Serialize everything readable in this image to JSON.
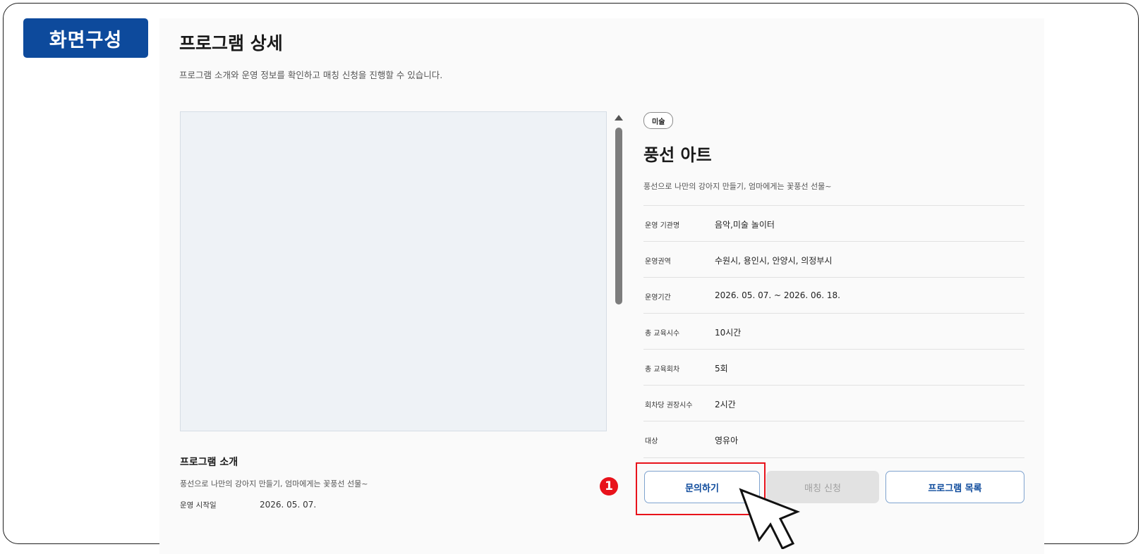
{
  "section_badge": "화면구성",
  "page": {
    "title": "프로그램 상세",
    "subtitle": "프로그램 소개와 운영 정보를 확인하고 매칭 신청을 진행할 수 있습니다."
  },
  "left": {
    "intro_heading": "프로그램 소개",
    "intro_text": "풍선으로 나만의 강아지 만들기, 엄마에게는 꽃풍선 선물~",
    "start_label": "운영 시작일",
    "start_value": "2026. 05. 07."
  },
  "program": {
    "category": "미술",
    "name": "풍선 아트",
    "description": "풍선으로 나만의 강아지 만들기, 엄마에게는 꽃풍선 선물~",
    "info": [
      {
        "label": "운영 기관명",
        "value": "음악,미술 놀이터"
      },
      {
        "label": "운영권역",
        "value": "수원시, 용인시, 안양시, 의정부시"
      },
      {
        "label": "운영기간",
        "value": "2026. 05. 07. ~ 2026. 06. 18."
      },
      {
        "label": "총 교육시수",
        "value": "10시간"
      },
      {
        "label": "총 교육회차",
        "value": "5회"
      },
      {
        "label": "회차당 권장시수",
        "value": "2시간"
      },
      {
        "label": "대상",
        "value": "영유아"
      }
    ]
  },
  "buttons": {
    "inquiry": "문의하기",
    "match": "매칭 신청",
    "list": "프로그램 목록"
  },
  "annotation": {
    "marker": "1"
  },
  "colors": {
    "brand": "#0d4a9c",
    "highlight": "#e8121b",
    "disabled": "#e2e2e2"
  }
}
